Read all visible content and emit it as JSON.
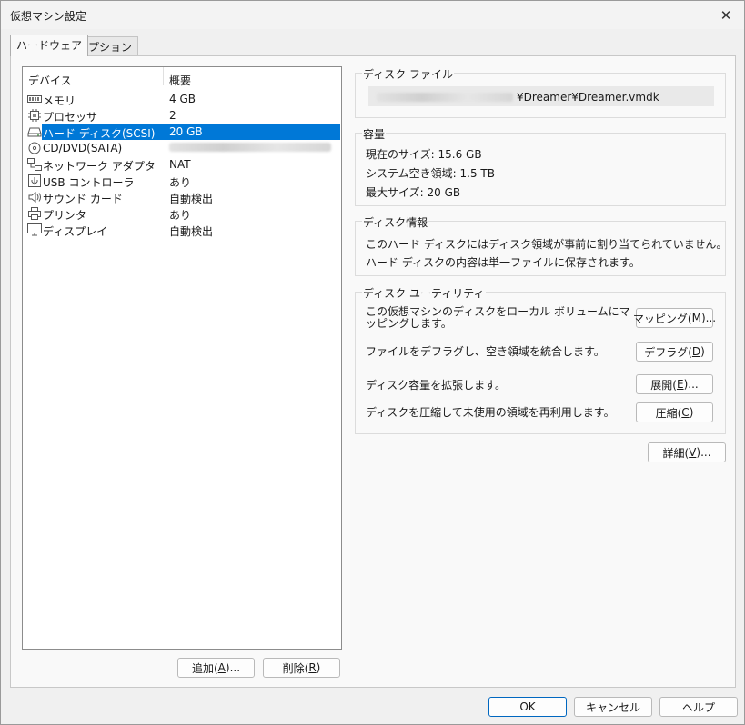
{
  "window": {
    "title": "仮想マシン設定",
    "close": "✕"
  },
  "tabs": [
    {
      "label": "ハードウェア"
    },
    {
      "label": "オプション"
    }
  ],
  "device_list": {
    "headers": {
      "device": "デバイス",
      "summary": "概要"
    },
    "rows": [
      {
        "name": "メモリ",
        "summary": "4 GB",
        "icon": "memory-icon"
      },
      {
        "name": "プロセッサ",
        "summary": "2",
        "icon": "processor-icon"
      },
      {
        "name": "ハード ディスク(SCSI)",
        "summary": "20 GB",
        "icon": "hard-disk-icon",
        "selected": true
      },
      {
        "name": "CD/DVD(SATA)",
        "summary": "",
        "icon": "cd-dvd-icon"
      },
      {
        "name": "ネットワーク アダプタ",
        "summary": "NAT",
        "icon": "network-adapter-icon"
      },
      {
        "name": "USB コントローラ",
        "summary": "あり",
        "icon": "usb-icon"
      },
      {
        "name": "サウンド カード",
        "summary": "自動検出",
        "icon": "speaker-icon"
      },
      {
        "name": "プリンタ",
        "summary": "あり",
        "icon": "printer-icon"
      },
      {
        "name": "ディスプレイ",
        "summary": "自動検出",
        "icon": "display-icon"
      }
    ]
  },
  "list_buttons": {
    "add": {
      "prefix": "追加(",
      "key": "A",
      "suffix": ")..."
    },
    "remove": {
      "prefix": "削除(",
      "key": "R",
      "suffix": ")"
    }
  },
  "disk_file": {
    "label": "ディスク ファイル",
    "path_suffix": "¥Dreamer¥Dreamer.vmdk"
  },
  "capacity": {
    "label": "容量",
    "current_size": "現在のサイズ: 15.6 GB",
    "system_free": "システム空き領域: 1.5 TB",
    "max_size": "最大サイズ: 20 GB"
  },
  "disk_info": {
    "label": "ディスク情報",
    "line1": "このハード ディスクにはディスク領域が事前に割り当てられていません。",
    "line2": "ハード ディスクの内容は単一ファイルに保存されます。"
  },
  "disk_utility": {
    "label": "ディスク ユーティリティ",
    "map_text": "この仮想マシンのディスクをローカル ボリュームにマッピングします。",
    "map_button": {
      "prefix": "マッピング(",
      "key": "M",
      "suffix": ")..."
    },
    "defrag_text": "ファイルをデフラグし、空き領域を統合します。",
    "defrag_button": {
      "prefix": "デフラグ(",
      "key": "D",
      "suffix": ")"
    },
    "expand_text": "ディスク容量を拡張します。",
    "expand_button": {
      "prefix": "展開(",
      "key": "E",
      "suffix": ")..."
    },
    "compact_text": "ディスクを圧縮して未使用の領域を再利用します。",
    "compact_button": {
      "prefix": "圧縮(",
      "key": "C",
      "suffix": ")"
    }
  },
  "advanced_button": {
    "prefix": "詳細(",
    "key": "V",
    "suffix": ")..."
  },
  "footer": {
    "ok": "OK",
    "cancel": "キャンセル",
    "help": "ヘルプ"
  },
  "colors": {
    "selection": "#0078d7",
    "primary_border": "#0067c0"
  }
}
